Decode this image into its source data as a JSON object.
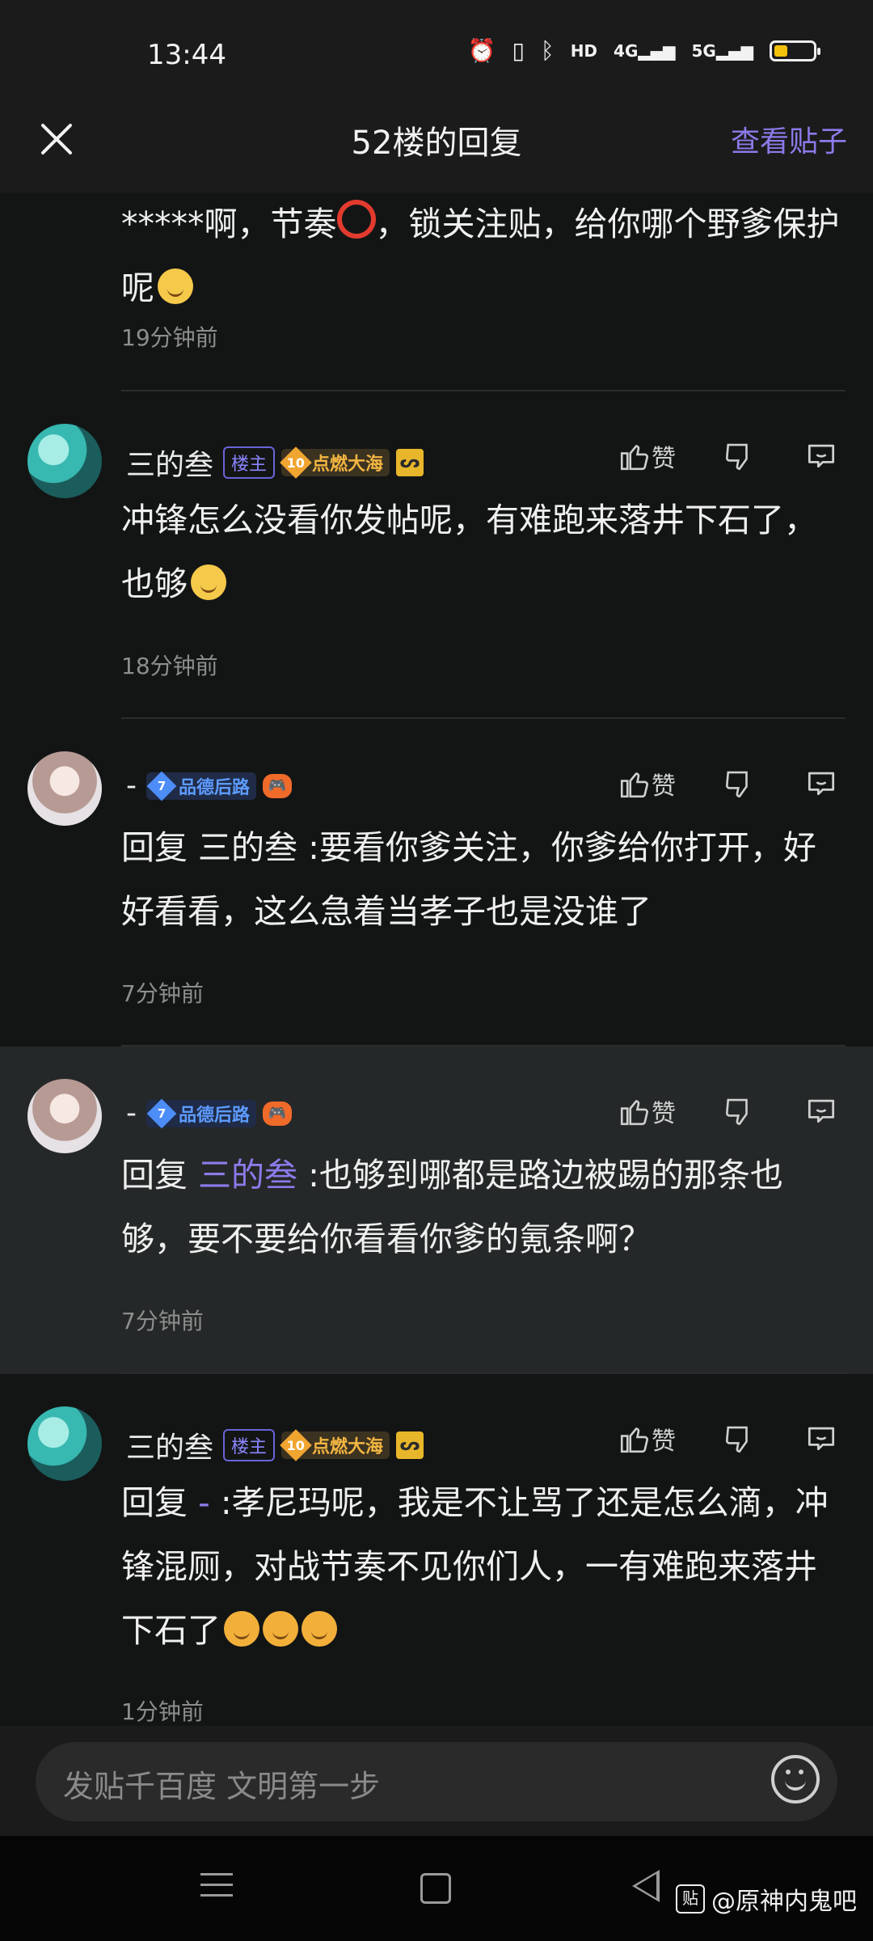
{
  "status": {
    "time": "13:44"
  },
  "header": {
    "title": "52楼的回复",
    "view_post": "查看贴子"
  },
  "top_item": {
    "text": "*****啊，节奏",
    "text2": "，锁关注贴，给你哪个野爹保护呢",
    "time": "19分钟前"
  },
  "comments": [
    {
      "user": "三的叁",
      "owner_badge": "楼主",
      "level": "10",
      "level_name": "点燃大海",
      "like_label": "赞",
      "content": "冲锋怎么没看你发帖呢，有难跑来落井下石了，也够",
      "time": "18分钟前"
    },
    {
      "user": "-",
      "level": "7",
      "level_name": "品德后路",
      "like_label": "赞",
      "content": "回复 三的叁 :要看你爹关注，你爹给你打开，好好看看，这么急着当孝子也是没谁了",
      "time": "7分钟前"
    },
    {
      "user": "-",
      "level": "7",
      "level_name": "品德后路",
      "like_label": "赞",
      "reply_prefix": "回复 ",
      "mention": "三的叁",
      "content": " :也够到哪都是路边被踢的那条也够，要不要给你看看你爹的氪条啊？",
      "time": "7分钟前"
    },
    {
      "user": "三的叁",
      "owner_badge": "楼主",
      "level": "10",
      "level_name": "点燃大海",
      "like_label": "赞",
      "reply_prefix": "回复 ",
      "mention": "-",
      "content": " :孝尼玛呢，我是不让骂了还是怎么滴，冲锋混厕，对战节奏不见你们人，一有难跑来落井下石了",
      "time": "1分钟前"
    }
  ],
  "composer": {
    "placeholder": "发贴千百度 文明第一步"
  },
  "watermark": {
    "logo": "贴",
    "text": "@原神内鬼吧"
  }
}
